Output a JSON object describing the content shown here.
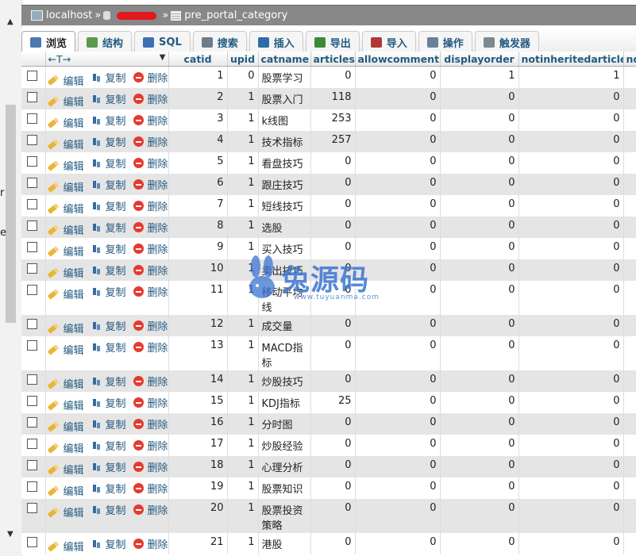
{
  "breadcrumb": {
    "server": "localhost",
    "separator": "»",
    "table": "pre_portal_category"
  },
  "tabs": [
    {
      "label": "浏览",
      "icon": "browse-icon",
      "active": true
    },
    {
      "label": "结构",
      "icon": "structure-icon"
    },
    {
      "label": "SQL",
      "icon": "sql-icon"
    },
    {
      "label": "搜索",
      "icon": "search-icon"
    },
    {
      "label": "插入",
      "icon": "insert-icon"
    },
    {
      "label": "导出",
      "icon": "export-icon"
    },
    {
      "label": "导入",
      "icon": "import-icon"
    },
    {
      "label": "操作",
      "icon": "wrench-icon"
    },
    {
      "label": "触发器",
      "icon": "trigger-icon"
    }
  ],
  "grid": {
    "arrows_label": "←T→",
    "columns": [
      "catid",
      "upid",
      "catname",
      "articles",
      "allowcomment",
      "displayorder",
      "notinheritedarticle",
      "notinhe"
    ],
    "actions": {
      "edit": "编辑",
      "copy": "复制",
      "delete": "删除"
    },
    "rows": [
      {
        "catid": "1",
        "upid": "0",
        "catname": "股票学习",
        "articles": "0",
        "allowcomment": "0",
        "displayorder": "1",
        "notinheritedarticle": "1"
      },
      {
        "catid": "2",
        "upid": "1",
        "catname": "股票入门",
        "articles": "118",
        "allowcomment": "0",
        "displayorder": "0",
        "notinheritedarticle": "0"
      },
      {
        "catid": "3",
        "upid": "1",
        "catname": "k线图",
        "articles": "253",
        "allowcomment": "0",
        "displayorder": "0",
        "notinheritedarticle": "0"
      },
      {
        "catid": "4",
        "upid": "1",
        "catname": "技术指标",
        "articles": "257",
        "allowcomment": "0",
        "displayorder": "0",
        "notinheritedarticle": "0"
      },
      {
        "catid": "5",
        "upid": "1",
        "catname": "看盘技巧",
        "articles": "0",
        "allowcomment": "0",
        "displayorder": "0",
        "notinheritedarticle": "0"
      },
      {
        "catid": "6",
        "upid": "1",
        "catname": "跟庄技巧",
        "articles": "0",
        "allowcomment": "0",
        "displayorder": "0",
        "notinheritedarticle": "0"
      },
      {
        "catid": "7",
        "upid": "1",
        "catname": "短线技巧",
        "articles": "0",
        "allowcomment": "0",
        "displayorder": "0",
        "notinheritedarticle": "0"
      },
      {
        "catid": "8",
        "upid": "1",
        "catname": "选股",
        "articles": "0",
        "allowcomment": "0",
        "displayorder": "0",
        "notinheritedarticle": "0"
      },
      {
        "catid": "9",
        "upid": "1",
        "catname": "买入技巧",
        "articles": "0",
        "allowcomment": "0",
        "displayorder": "0",
        "notinheritedarticle": "0"
      },
      {
        "catid": "10",
        "upid": "1",
        "catname": "卖出技巧",
        "articles": "0",
        "allowcomment": "0",
        "displayorder": "0",
        "notinheritedarticle": "0"
      },
      {
        "catid": "11",
        "upid": "1",
        "catname": "移动平均线",
        "articles": "0",
        "allowcomment": "0",
        "displayorder": "0",
        "notinheritedarticle": "0"
      },
      {
        "catid": "12",
        "upid": "1",
        "catname": "成交量",
        "articles": "0",
        "allowcomment": "0",
        "displayorder": "0",
        "notinheritedarticle": "0"
      },
      {
        "catid": "13",
        "upid": "1",
        "catname": "MACD指标",
        "articles": "0",
        "allowcomment": "0",
        "displayorder": "0",
        "notinheritedarticle": "0"
      },
      {
        "catid": "14",
        "upid": "1",
        "catname": "炒股技巧",
        "articles": "0",
        "allowcomment": "0",
        "displayorder": "0",
        "notinheritedarticle": "0"
      },
      {
        "catid": "15",
        "upid": "1",
        "catname": "KDJ指标",
        "articles": "25",
        "allowcomment": "0",
        "displayorder": "0",
        "notinheritedarticle": "0"
      },
      {
        "catid": "16",
        "upid": "1",
        "catname": "分时图",
        "articles": "0",
        "allowcomment": "0",
        "displayorder": "0",
        "notinheritedarticle": "0"
      },
      {
        "catid": "17",
        "upid": "1",
        "catname": "炒股经验",
        "articles": "0",
        "allowcomment": "0",
        "displayorder": "0",
        "notinheritedarticle": "0"
      },
      {
        "catid": "18",
        "upid": "1",
        "catname": "心理分析",
        "articles": "0",
        "allowcomment": "0",
        "displayorder": "0",
        "notinheritedarticle": "0"
      },
      {
        "catid": "19",
        "upid": "1",
        "catname": "股票知识",
        "articles": "0",
        "allowcomment": "0",
        "displayorder": "0",
        "notinheritedarticle": "0"
      },
      {
        "catid": "20",
        "upid": "1",
        "catname": "股票投资策略",
        "articles": "0",
        "allowcomment": "0",
        "displayorder": "0",
        "notinheritedarticle": "0"
      },
      {
        "catid": "21",
        "upid": "1",
        "catname": "港股",
        "articles": "0",
        "allowcomment": "0",
        "displayorder": "0",
        "notinheritedarticle": "0"
      }
    ]
  },
  "left_fragments": [
    "r",
    "e"
  ],
  "watermark": {
    "brand": "兔源码",
    "url": "www.tuyuanma.com"
  },
  "colors": {
    "link": "#235a81",
    "even_row": "#e5e5e5",
    "breadcrumb_bg": "#888888",
    "delete": "#e53b2f",
    "watermark": "#3a76d0"
  }
}
